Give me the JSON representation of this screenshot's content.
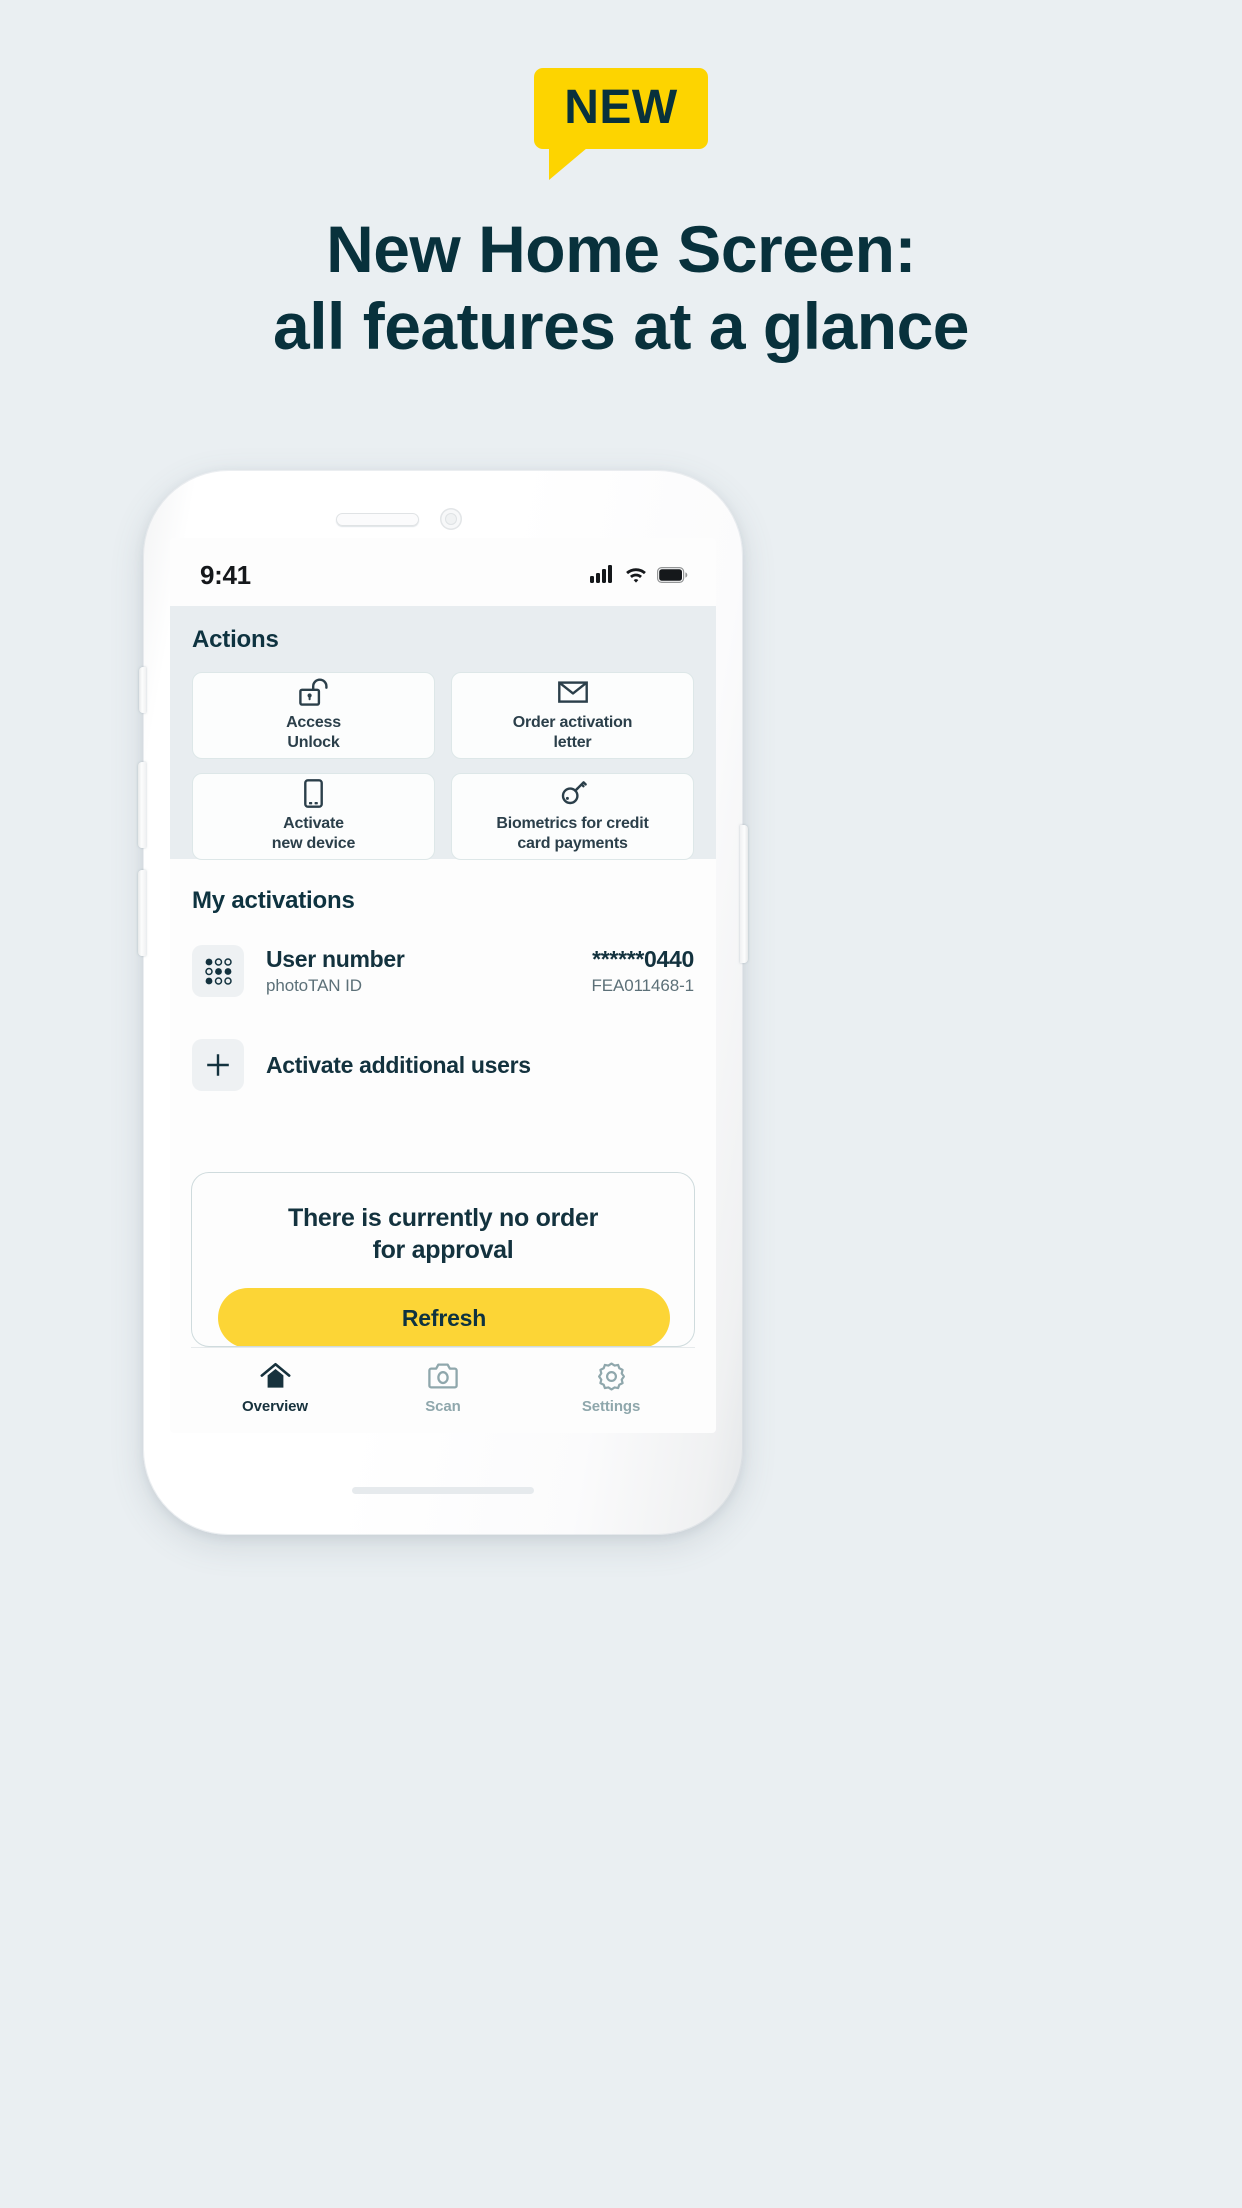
{
  "promo": {
    "badge": "NEW",
    "title_line1": "New Home Screen:",
    "title_line2": "all features at a glance",
    "colors": {
      "background": "#eaeff2",
      "accent_yellow": "#fdd400",
      "heading_navy": "#08313c"
    }
  },
  "phone": {
    "status_bar": {
      "time": "9:41",
      "icons": [
        "cellular-signal-icon",
        "wifi-icon",
        "battery-icon"
      ]
    },
    "home_indicator": true
  },
  "screen": {
    "actions": {
      "heading": "Actions",
      "cards": [
        {
          "icon": "unlock-padlock-icon",
          "label": "Access\nUnlock"
        },
        {
          "icon": "envelope-icon",
          "label": "Order activation\nletter"
        },
        {
          "icon": "smartphone-icon",
          "label": "Activate\nnew device"
        },
        {
          "icon": "key-icon",
          "label": "Biometrics for credit\ncard payments"
        }
      ]
    },
    "activations": {
      "heading": "My activations",
      "rows": [
        {
          "icon": "phototan-dots-icon",
          "title": "User number",
          "subtitle": "photoTAN ID",
          "value": "******0440",
          "value_sub": "FEA011468-1"
        }
      ],
      "add_row": {
        "icon": "plus-icon",
        "label": "Activate additional users"
      }
    },
    "approval": {
      "message": "There is currently no order\nfor approval",
      "refresh_label": "Refresh",
      "button_color": "#fcd536"
    },
    "tab_bar": {
      "tabs": [
        {
          "icon": "home-icon",
          "label": "Overview",
          "active": true
        },
        {
          "icon": "camera-icon",
          "label": "Scan",
          "active": false
        },
        {
          "icon": "gear-icon",
          "label": "Settings",
          "active": false
        }
      ]
    }
  }
}
